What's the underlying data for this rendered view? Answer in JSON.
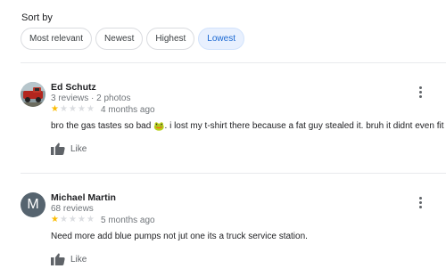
{
  "sort": {
    "label": "Sort by",
    "options": [
      "Most relevant",
      "Newest",
      "Highest",
      "Lowest"
    ],
    "selected": "Lowest"
  },
  "colors": {
    "star_filled": "#fbbc04",
    "star_empty": "#dadce0",
    "chip_active": "#e8f0fe"
  },
  "reviews": [
    {
      "name": "Ed Schutz",
      "meta": "3 reviews · 2 photos",
      "rating": 1,
      "max_rating": 5,
      "date": "4 months ago",
      "text_before": "bro the gas tastes so bad",
      "emoji": "🐸",
      "text_after": ". i lost my t-shirt there because a fat guy stealed it. bruh it didnt even fit him",
      "like_label": "Like",
      "avatar_icon": "truck-photo"
    },
    {
      "name": "Michael Martin",
      "meta": "68 reviews",
      "rating": 1,
      "max_rating": 5,
      "date": "5 months ago",
      "text": "Need more add blue pumps not jut one its a truck service station.",
      "like_label": "Like",
      "avatar_letter": "M"
    }
  ]
}
